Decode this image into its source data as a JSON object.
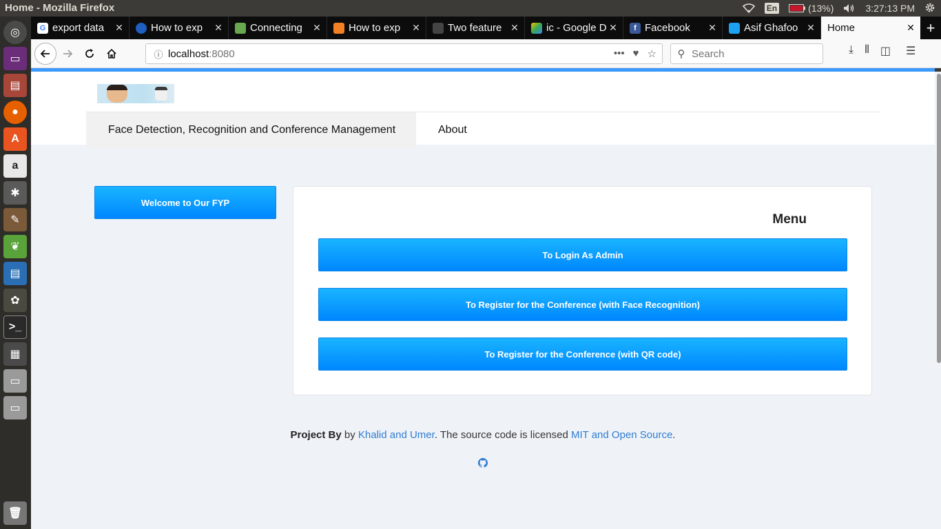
{
  "system": {
    "window_title": "Home - Mozilla Firefox",
    "keyboard_layout": "En",
    "battery": "(13%)",
    "time": "3:27:13 PM"
  },
  "tabs": [
    {
      "label": "export data",
      "favicon": "google-icon"
    },
    {
      "label": "How to exp",
      "favicon": "blue-circle-icon"
    },
    {
      "label": "Connecting",
      "favicon": "green-leaf-icon"
    },
    {
      "label": "How to exp",
      "favicon": "stackoverflow-icon"
    },
    {
      "label": "Two feature",
      "favicon": "logo-icon"
    },
    {
      "label": "ic - Google D",
      "favicon": "google-drive-icon"
    },
    {
      "label": "Facebook",
      "favicon": "facebook-icon"
    },
    {
      "label": "Asif Ghafoo",
      "favicon": "twitter-icon"
    },
    {
      "label": "Home",
      "favicon": "none",
      "active": true
    }
  ],
  "navbar": {
    "url_host": "localhost",
    "url_port": ":8080",
    "search_placeholder": "Search"
  },
  "site": {
    "nav_title": "Face Detection, Recognition and Conference Management",
    "nav_about": "About",
    "welcome": "Welcome to Our FYP"
  },
  "menu": {
    "title": "Menu",
    "buttons": [
      "To Login As Admin",
      "To Register for the Conference (with Face Recognition)",
      "To Register for the Conference (with QR code)"
    ]
  },
  "footer": {
    "project_by": "Project By",
    "by": " by ",
    "authors": "Khalid and Umer",
    "text": ". The source code is licensed ",
    "license": "MIT and Open Source",
    "end": "."
  },
  "colors": {
    "accent": "#3b99fc",
    "button_top": "#19b4ff",
    "button_bottom": "#0087ff",
    "link": "#2f7bd3"
  }
}
